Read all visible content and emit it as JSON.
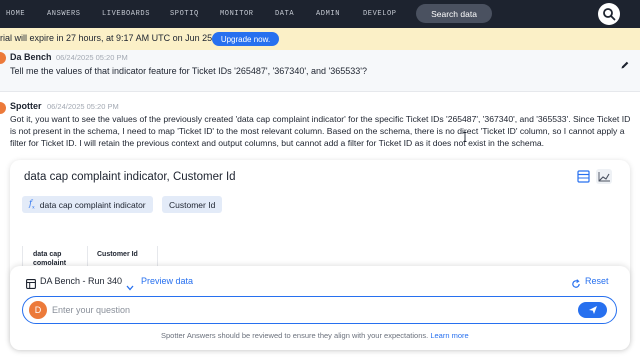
{
  "nav": {
    "items": [
      "HOME",
      "ANSWERS",
      "LIVEBOARDS",
      "SPOTIQ",
      "MONITOR",
      "DATA",
      "ADMIN",
      "DEVELOP"
    ],
    "search_label": "Search data"
  },
  "banner": {
    "text": "rial will expire in 27 hours, at 9:17 AM UTC on Jun 25.",
    "upgrade_label": "Upgrade now."
  },
  "user_message": {
    "author": "Da Bench",
    "timestamp": "06/24/2025 05:20 PM",
    "text": "Tell me the values of that indicator feature for Ticket IDs '265487', '367340', and '365533'?"
  },
  "spotter_message": {
    "author": "Spotter",
    "timestamp": "06/24/2025 05:20 PM",
    "text": "Got it, you want to see the values of the previously created 'data cap complaint indicator' for the specific Ticket IDs '265487', '367340', and '365533'. Since Ticket ID is not present in the schema, I need to map 'Ticket ID' to the most relevant column. Based on the schema, there is no direct 'Ticket ID' column, so I cannot apply a filter for Ticket ID. I will retain the previous context and output columns, but cannot add a filter for Ticket ID as it does not exist in the schema."
  },
  "result_card": {
    "title": "data cap complaint indicator, Customer Id",
    "chips": [
      {
        "label": "data cap complaint indicator",
        "has_formula_icon": true
      },
      {
        "label": "Customer Id",
        "has_formula_icon": false
      }
    ],
    "columns": [
      "data cap comolaint",
      "Customer Id"
    ]
  },
  "input_panel": {
    "run_label": "DA Bench - Run 340",
    "preview_label": "Preview data",
    "reset_label": "Reset",
    "avatar_letter": "D",
    "placeholder": "Enter your question",
    "disclaimer": "Spotter Answers should be reviewed to ensure they align with your expectations.",
    "learn_more": "Learn more"
  },
  "colors": {
    "nav_bg": "#1d232f",
    "accent": "#2770ef",
    "banner_bg": "#fbf0c7",
    "avatar": "#ec7a3a",
    "chip_bg": "#e3ebf8"
  },
  "icons": [
    "search-icon",
    "pencil-icon",
    "table-view-icon",
    "chart-view-icon",
    "table-icon",
    "chevron-down-icon",
    "reset-icon",
    "send-icon",
    "formula-icon"
  ]
}
